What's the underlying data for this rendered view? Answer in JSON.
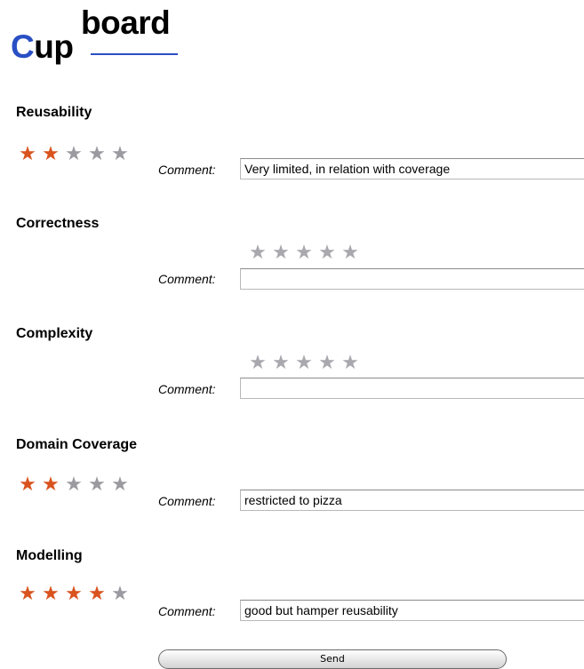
{
  "logo": {
    "top": "board",
    "bottom_c": "C",
    "bottom_rest": "up"
  },
  "comment_label": "Comment:",
  "star_glyph": "★",
  "colors": {
    "star_on": "#d9531e",
    "star_off": "#9a9aa0",
    "logo_accent": "#2a4fc4"
  },
  "criteria": [
    {
      "name": "Reusability",
      "rating": 2,
      "max": 5,
      "comment": "Very limited, in relation with coverage"
    },
    {
      "name": "Correctness",
      "rating": 0,
      "max": 5,
      "comment": ""
    },
    {
      "name": "Complexity",
      "rating": 0,
      "max": 5,
      "comment": ""
    },
    {
      "name": "Domain Coverage",
      "rating": 2,
      "max": 5,
      "comment": "restricted to pizza"
    },
    {
      "name": "Modelling",
      "rating": 4,
      "max": 5,
      "comment": "good but hamper reusability"
    }
  ],
  "send_label": "Send"
}
